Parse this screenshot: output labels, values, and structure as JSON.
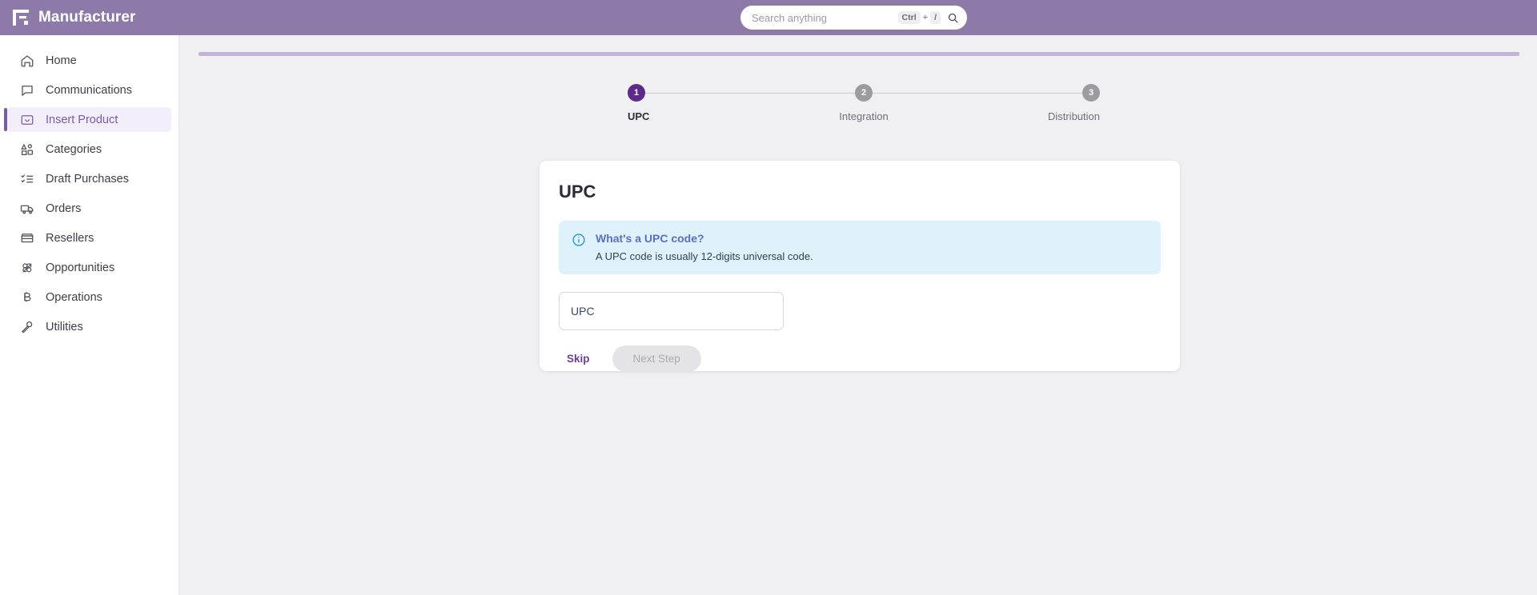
{
  "header": {
    "brand_name": "Manufacturer",
    "logo_icon": "manufacturer-logo-icon",
    "search": {
      "placeholder": "Search anything",
      "value": "",
      "shortcut_key1": "Ctrl",
      "shortcut_plus": "+",
      "shortcut_key2": "/",
      "icon": "search-icon"
    },
    "background_color": "#8e7aa8"
  },
  "sidebar": {
    "items": [
      {
        "label": "Home",
        "icon": "home-icon",
        "active": false
      },
      {
        "label": "Communications",
        "icon": "chat-bubble-icon",
        "active": false
      },
      {
        "label": "Insert Product",
        "icon": "product-box-icon",
        "active": true
      },
      {
        "label": "Categories",
        "icon": "categories-people-icon",
        "active": false
      },
      {
        "label": "Draft Purchases",
        "icon": "checklist-icon",
        "active": false
      },
      {
        "label": "Orders",
        "icon": "truck-icon",
        "active": false
      },
      {
        "label": "Resellers",
        "icon": "store-icon",
        "active": false
      },
      {
        "label": "Opportunities",
        "icon": "clover-icon",
        "active": false
      },
      {
        "label": "Operations",
        "icon": "bitcoin-icon",
        "active": false
      },
      {
        "label": "Utilities",
        "icon": "wrench-icon",
        "active": false
      }
    ],
    "active_color": "#7b5aa6",
    "active_background": "#f3effa"
  },
  "stepper": {
    "steps": [
      {
        "number": "1",
        "label": "UPC",
        "state": "active"
      },
      {
        "number": "2",
        "label": "Integration",
        "state": "inactive"
      },
      {
        "number": "3",
        "label": "Distribution",
        "state": "inactive"
      }
    ],
    "active_color": "#5d2a8c",
    "inactive_color": "#9b9ba2"
  },
  "card": {
    "title": "UPC",
    "alert": {
      "icon": "info-circle-icon",
      "title": "What's a UPC code?",
      "body": "A UPC code is usually 12-digits universal code.",
      "background_color": "#dff1fb"
    },
    "upc_field": {
      "placeholder": "UPC",
      "value": ""
    },
    "skip_label": "Skip",
    "next_label": "Next Step"
  }
}
